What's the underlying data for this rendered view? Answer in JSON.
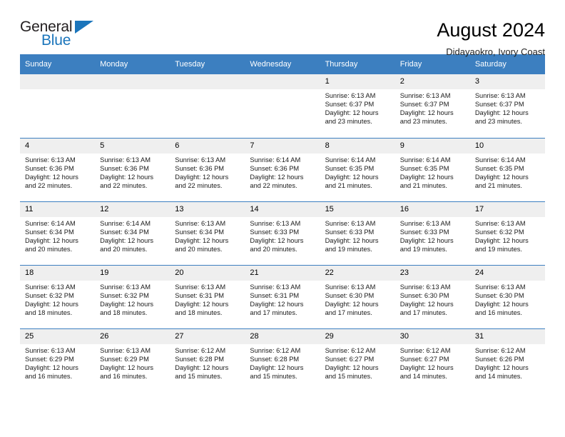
{
  "brand": {
    "name_part1": "General",
    "name_part2": "Blue",
    "triangle_color": "#1b75bb"
  },
  "header": {
    "title": "August 2024",
    "subtitle": "Didayaokro, Ivory Coast"
  },
  "theme": {
    "header_blue": "#3c7fc0",
    "daynum_gray": "#efefef"
  },
  "weekdays": [
    "Sunday",
    "Monday",
    "Tuesday",
    "Wednesday",
    "Thursday",
    "Friday",
    "Saturday"
  ],
  "weeks": [
    [
      {
        "day": "",
        "sunrise": "",
        "sunset": "",
        "daylight": ""
      },
      {
        "day": "",
        "sunrise": "",
        "sunset": "",
        "daylight": ""
      },
      {
        "day": "",
        "sunrise": "",
        "sunset": "",
        "daylight": ""
      },
      {
        "day": "",
        "sunrise": "",
        "sunset": "",
        "daylight": ""
      },
      {
        "day": "1",
        "sunrise": "Sunrise: 6:13 AM",
        "sunset": "Sunset: 6:37 PM",
        "daylight": "Daylight: 12 hours and 23 minutes."
      },
      {
        "day": "2",
        "sunrise": "Sunrise: 6:13 AM",
        "sunset": "Sunset: 6:37 PM",
        "daylight": "Daylight: 12 hours and 23 minutes."
      },
      {
        "day": "3",
        "sunrise": "Sunrise: 6:13 AM",
        "sunset": "Sunset: 6:37 PM",
        "daylight": "Daylight: 12 hours and 23 minutes."
      }
    ],
    [
      {
        "day": "4",
        "sunrise": "Sunrise: 6:13 AM",
        "sunset": "Sunset: 6:36 PM",
        "daylight": "Daylight: 12 hours and 22 minutes."
      },
      {
        "day": "5",
        "sunrise": "Sunrise: 6:13 AM",
        "sunset": "Sunset: 6:36 PM",
        "daylight": "Daylight: 12 hours and 22 minutes."
      },
      {
        "day": "6",
        "sunrise": "Sunrise: 6:13 AM",
        "sunset": "Sunset: 6:36 PM",
        "daylight": "Daylight: 12 hours and 22 minutes."
      },
      {
        "day": "7",
        "sunrise": "Sunrise: 6:14 AM",
        "sunset": "Sunset: 6:36 PM",
        "daylight": "Daylight: 12 hours and 22 minutes."
      },
      {
        "day": "8",
        "sunrise": "Sunrise: 6:14 AM",
        "sunset": "Sunset: 6:35 PM",
        "daylight": "Daylight: 12 hours and 21 minutes."
      },
      {
        "day": "9",
        "sunrise": "Sunrise: 6:14 AM",
        "sunset": "Sunset: 6:35 PM",
        "daylight": "Daylight: 12 hours and 21 minutes."
      },
      {
        "day": "10",
        "sunrise": "Sunrise: 6:14 AM",
        "sunset": "Sunset: 6:35 PM",
        "daylight": "Daylight: 12 hours and 21 minutes."
      }
    ],
    [
      {
        "day": "11",
        "sunrise": "Sunrise: 6:14 AM",
        "sunset": "Sunset: 6:34 PM",
        "daylight": "Daylight: 12 hours and 20 minutes."
      },
      {
        "day": "12",
        "sunrise": "Sunrise: 6:14 AM",
        "sunset": "Sunset: 6:34 PM",
        "daylight": "Daylight: 12 hours and 20 minutes."
      },
      {
        "day": "13",
        "sunrise": "Sunrise: 6:13 AM",
        "sunset": "Sunset: 6:34 PM",
        "daylight": "Daylight: 12 hours and 20 minutes."
      },
      {
        "day": "14",
        "sunrise": "Sunrise: 6:13 AM",
        "sunset": "Sunset: 6:33 PM",
        "daylight": "Daylight: 12 hours and 20 minutes."
      },
      {
        "day": "15",
        "sunrise": "Sunrise: 6:13 AM",
        "sunset": "Sunset: 6:33 PM",
        "daylight": "Daylight: 12 hours and 19 minutes."
      },
      {
        "day": "16",
        "sunrise": "Sunrise: 6:13 AM",
        "sunset": "Sunset: 6:33 PM",
        "daylight": "Daylight: 12 hours and 19 minutes."
      },
      {
        "day": "17",
        "sunrise": "Sunrise: 6:13 AM",
        "sunset": "Sunset: 6:32 PM",
        "daylight": "Daylight: 12 hours and 19 minutes."
      }
    ],
    [
      {
        "day": "18",
        "sunrise": "Sunrise: 6:13 AM",
        "sunset": "Sunset: 6:32 PM",
        "daylight": "Daylight: 12 hours and 18 minutes."
      },
      {
        "day": "19",
        "sunrise": "Sunrise: 6:13 AM",
        "sunset": "Sunset: 6:32 PM",
        "daylight": "Daylight: 12 hours and 18 minutes."
      },
      {
        "day": "20",
        "sunrise": "Sunrise: 6:13 AM",
        "sunset": "Sunset: 6:31 PM",
        "daylight": "Daylight: 12 hours and 18 minutes."
      },
      {
        "day": "21",
        "sunrise": "Sunrise: 6:13 AM",
        "sunset": "Sunset: 6:31 PM",
        "daylight": "Daylight: 12 hours and 17 minutes."
      },
      {
        "day": "22",
        "sunrise": "Sunrise: 6:13 AM",
        "sunset": "Sunset: 6:30 PM",
        "daylight": "Daylight: 12 hours and 17 minutes."
      },
      {
        "day": "23",
        "sunrise": "Sunrise: 6:13 AM",
        "sunset": "Sunset: 6:30 PM",
        "daylight": "Daylight: 12 hours and 17 minutes."
      },
      {
        "day": "24",
        "sunrise": "Sunrise: 6:13 AM",
        "sunset": "Sunset: 6:30 PM",
        "daylight": "Daylight: 12 hours and 16 minutes."
      }
    ],
    [
      {
        "day": "25",
        "sunrise": "Sunrise: 6:13 AM",
        "sunset": "Sunset: 6:29 PM",
        "daylight": "Daylight: 12 hours and 16 minutes."
      },
      {
        "day": "26",
        "sunrise": "Sunrise: 6:13 AM",
        "sunset": "Sunset: 6:29 PM",
        "daylight": "Daylight: 12 hours and 16 minutes."
      },
      {
        "day": "27",
        "sunrise": "Sunrise: 6:12 AM",
        "sunset": "Sunset: 6:28 PM",
        "daylight": "Daylight: 12 hours and 15 minutes."
      },
      {
        "day": "28",
        "sunrise": "Sunrise: 6:12 AM",
        "sunset": "Sunset: 6:28 PM",
        "daylight": "Daylight: 12 hours and 15 minutes."
      },
      {
        "day": "29",
        "sunrise": "Sunrise: 6:12 AM",
        "sunset": "Sunset: 6:27 PM",
        "daylight": "Daylight: 12 hours and 15 minutes."
      },
      {
        "day": "30",
        "sunrise": "Sunrise: 6:12 AM",
        "sunset": "Sunset: 6:27 PM",
        "daylight": "Daylight: 12 hours and 14 minutes."
      },
      {
        "day": "31",
        "sunrise": "Sunrise: 6:12 AM",
        "sunset": "Sunset: 6:26 PM",
        "daylight": "Daylight: 12 hours and 14 minutes."
      }
    ]
  ]
}
